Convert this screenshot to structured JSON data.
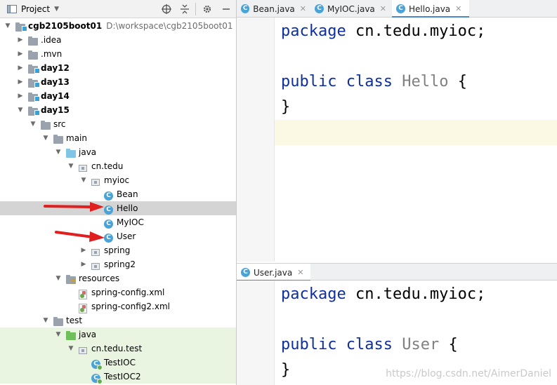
{
  "project_panel": {
    "title": "Project",
    "toolbar_icons": [
      "locate-icon",
      "collapse-icon",
      "gear-icon",
      "minimize-icon"
    ]
  },
  "tree": [
    {
      "label": "cgb2105boot01",
      "path": "D:\\workspace\\cgb2105boot01",
      "bold": true,
      "icon": "module-folder",
      "arrow": "down",
      "indent": 0
    },
    {
      "label": ".idea",
      "icon": "folder",
      "arrow": "right",
      "indent": 1
    },
    {
      "label": ".mvn",
      "icon": "folder",
      "arrow": "right",
      "indent": 1
    },
    {
      "label": "day12",
      "icon": "module-folder",
      "arrow": "right",
      "indent": 1,
      "bold": true
    },
    {
      "label": "day13",
      "icon": "module-folder",
      "arrow": "right",
      "indent": 1,
      "bold": true
    },
    {
      "label": "day14",
      "icon": "module-folder",
      "arrow": "right",
      "indent": 1,
      "bold": true
    },
    {
      "label": "day15",
      "icon": "module-folder",
      "arrow": "down",
      "indent": 1,
      "bold": true
    },
    {
      "label": "src",
      "icon": "folder",
      "arrow": "down",
      "indent": 2
    },
    {
      "label": "main",
      "icon": "folder",
      "arrow": "down",
      "indent": 3
    },
    {
      "label": "java",
      "icon": "source-folder",
      "arrow": "down",
      "indent": 4
    },
    {
      "label": "cn.tedu",
      "icon": "package",
      "arrow": "down",
      "indent": 5
    },
    {
      "label": "myioc",
      "icon": "package",
      "arrow": "down",
      "indent": 6
    },
    {
      "label": "Bean",
      "icon": "class",
      "arrow": "",
      "indent": 7
    },
    {
      "label": "Hello",
      "icon": "class",
      "arrow": "",
      "indent": 7,
      "selected": true
    },
    {
      "label": "MyIOC",
      "icon": "class",
      "arrow": "",
      "indent": 7
    },
    {
      "label": "User",
      "icon": "class",
      "arrow": "",
      "indent": 7
    },
    {
      "label": "spring",
      "icon": "package",
      "arrow": "right",
      "indent": 6
    },
    {
      "label": "spring2",
      "icon": "package",
      "arrow": "right",
      "indent": 6
    },
    {
      "label": "resources",
      "icon": "resources-folder",
      "arrow": "down",
      "indent": 4
    },
    {
      "label": "spring-config.xml",
      "icon": "xml",
      "arrow": "",
      "indent": 5
    },
    {
      "label": "spring-config2.xml",
      "icon": "xml",
      "arrow": "",
      "indent": 5
    },
    {
      "label": "test",
      "icon": "folder",
      "arrow": "down",
      "indent": 3
    },
    {
      "label": "java",
      "icon": "test-folder",
      "arrow": "down",
      "indent": 4,
      "green": true
    },
    {
      "label": "cn.tedu.test",
      "icon": "package",
      "arrow": "down",
      "indent": 5,
      "green": true
    },
    {
      "label": "TestIOC",
      "icon": "test-class",
      "arrow": "",
      "indent": 6,
      "green": true
    },
    {
      "label": "TestIOC2",
      "icon": "test-class",
      "arrow": "",
      "indent": 6,
      "green": true
    }
  ],
  "top_editor": {
    "tabs": [
      {
        "label": "Bean.java",
        "active": false
      },
      {
        "label": "MyIOC.java",
        "active": false
      },
      {
        "label": "Hello.java",
        "active": true
      }
    ],
    "code": {
      "line1_kw": "package",
      "line1_rest": "cn.tedu.myioc;",
      "line3_kw1": "public",
      "line3_kw2": "class",
      "line3_name": "Hello",
      "line3_brace": "{",
      "line4": "}"
    }
  },
  "bottom_editor": {
    "tabs": [
      {
        "label": "User.java",
        "active": true
      }
    ],
    "code": {
      "line1_kw": "package",
      "line1_rest": "cn.tedu.myioc;",
      "line3_kw1": "public",
      "line3_kw2": "class",
      "line3_name": "User",
      "line3_brace": "{",
      "line4": "}"
    }
  },
  "watermark": "https://blog.csdn.net/AimerDaniel",
  "colors": {
    "keyword": "#0f2fa0",
    "selection": "#d4d4d4",
    "test_bg": "#eaf5e1",
    "arrow_red": "#e02020"
  }
}
